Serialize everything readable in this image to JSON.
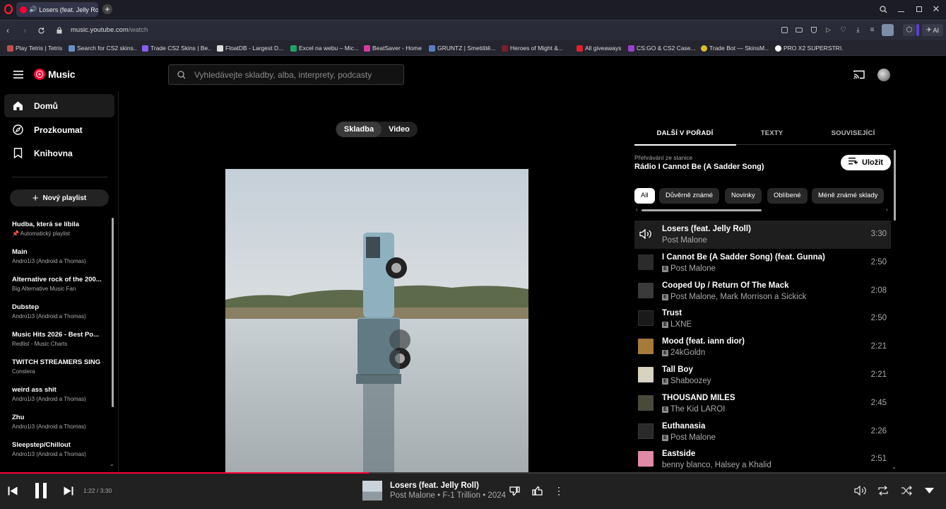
{
  "browser": {
    "tab_title": "Losers (feat. Jelly Roll)",
    "url_host": "music.youtube.com",
    "url_path": "/watch",
    "ai_label": "AI",
    "bookmarks": [
      {
        "label": "Play Tetris | Tetris",
        "color": "#c0504d"
      },
      {
        "label": "Search for CS2 skins...",
        "color": "#6a8fc7"
      },
      {
        "label": "Trade CS2 Skins | Be...",
        "color": "#8a5cf6"
      },
      {
        "label": "FloatDB - Largest D...",
        "color": "#dddddd"
      },
      {
        "label": "Excel na webu – Mic...",
        "color": "#21a366"
      },
      {
        "label": "BeatSaver - Home",
        "color": "#d63aa1"
      },
      {
        "label": "GRUNTZ | Smetiště...",
        "color": "#5a7fc0"
      },
      {
        "label": "Heroes of Might &...",
        "color": "#7a1f2b"
      },
      {
        "label": "All giveaways",
        "color": "#e0202e"
      },
      {
        "label": "CS:GO & CS2 Case...",
        "color": "#9b3fd1"
      },
      {
        "label": "Trade Bot — SkinsM...",
        "color": "#e0c020"
      },
      {
        "label": "PRO X2 SUPERSTRI...",
        "color": "#ffffff"
      }
    ]
  },
  "header": {
    "logo_text": "Music",
    "search_placeholder": "Vyhledávejte skladby, alba, interprety, podcasty"
  },
  "sidebar": {
    "nav": [
      {
        "label": "Domů",
        "icon": "home-icon"
      },
      {
        "label": "Prozkoumat",
        "icon": "compass-icon"
      },
      {
        "label": "Knihovna",
        "icon": "library-icon"
      }
    ],
    "new_playlist": "Nový playlist",
    "playlists": [
      {
        "title": "Hudba, která se líbila",
        "subtitle": "Automatický playlist",
        "pinned": true
      },
      {
        "title": "Main",
        "subtitle": "Andro1i3 (Android a Thomas)"
      },
      {
        "title": "Alternative rock of the 200...",
        "subtitle": "Big Alternative Music Fan"
      },
      {
        "title": "Dubstep",
        "subtitle": "Andro1i3 (Android a Thomas)"
      },
      {
        "title": "Music Hits 2026 - Best Po...",
        "subtitle": "Redlist - Music Charts"
      },
      {
        "title": "TWITCH STREAMERS SING",
        "subtitle": "Constera"
      },
      {
        "title": "weird ass shit",
        "subtitle": "Andro1i3 (Android a Thomas)"
      },
      {
        "title": "Zhu",
        "subtitle": "Andro1i3 (Android a Thomas)"
      },
      {
        "title": "Sleepstep/Chillout",
        "subtitle": "Andro1i3 (Android a Thomas)"
      }
    ]
  },
  "main": {
    "toggle": {
      "song": "Skladba",
      "video": "Video",
      "active": "song"
    }
  },
  "queue": {
    "tabs": [
      "DALŠÍ V POŘADÍ",
      "TEXTY",
      "SOUVISEJÍCÍ"
    ],
    "station_label": "Přehrávání ze stanice",
    "station_name": "Rádio I Cannot Be (A Sadder Song)",
    "save_label": "Uložit",
    "chips": [
      "All",
      "Důvěrně známé",
      "Novinky",
      "Oblíbené",
      "Méně známé sklady"
    ],
    "items": [
      {
        "title": "Losers (feat. Jelly Roll)",
        "artist": "Post Malone",
        "duration": "3:30",
        "explicit": false,
        "playing": true,
        "thumb": "#cfd6dd"
      },
      {
        "title": "I Cannot Be (A Sadder Song) (feat. Gunna)",
        "artist": "Post Malone",
        "duration": "2:50",
        "explicit": true,
        "thumb": "#2b2b2b"
      },
      {
        "title": "Cooped Up / Return Of The Mack",
        "artist": "Post Malone, Mark Morrison a Sickick",
        "duration": "2:08",
        "explicit": true,
        "thumb": "#3a3a3a"
      },
      {
        "title": "Trust",
        "artist": "LXNE",
        "duration": "2:50",
        "explicit": true,
        "thumb": "#1a1a1a"
      },
      {
        "title": "Mood (feat. iann dior)",
        "artist": "24kGoldn",
        "duration": "2:21",
        "explicit": true,
        "thumb": "#a67a3a"
      },
      {
        "title": "Tall Boy",
        "artist": "Shaboozey",
        "duration": "2:21",
        "explicit": true,
        "thumb": "#d8d2c0"
      },
      {
        "title": "THOUSAND MILES",
        "artist": "The Kid LAROI",
        "duration": "2:45",
        "explicit": true,
        "thumb": "#4a4a3a"
      },
      {
        "title": "Euthanasia",
        "artist": "Post Malone",
        "duration": "2:26",
        "explicit": true,
        "thumb": "#2a2a2a"
      },
      {
        "title": "Eastside",
        "artist": "benny blanco, Halsey a Khalid",
        "duration": "2:51",
        "explicit": false,
        "thumb": "#e08aa8"
      }
    ]
  },
  "player": {
    "time": "1:22 / 3:30",
    "progress": 0.39,
    "title": "Losers (feat. Jelly Roll)",
    "subtitle": "Post Malone • F-1 Trillion • 2024"
  }
}
